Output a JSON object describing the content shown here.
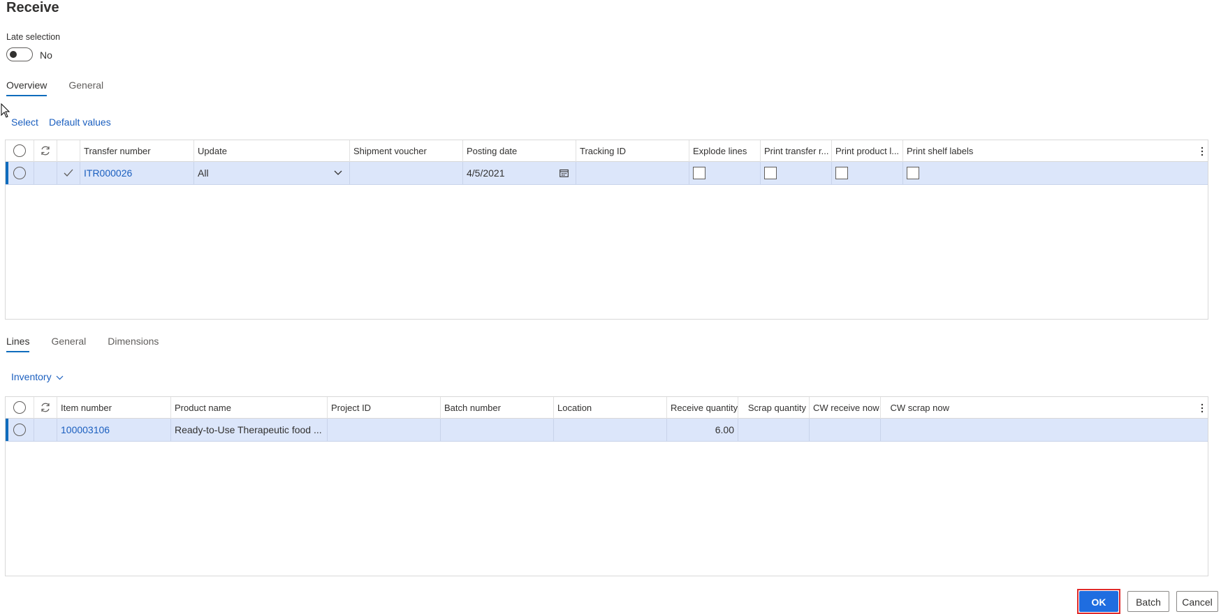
{
  "page": {
    "title": "Receive"
  },
  "late_selection": {
    "label": "Late selection",
    "value": "No"
  },
  "upper_tabs": [
    "Overview",
    "General"
  ],
  "upper_actions": {
    "select": "Select",
    "default_values": "Default values"
  },
  "header_grid": {
    "columns": [
      "Transfer number",
      "Update",
      "Shipment voucher",
      "Posting date",
      "Tracking ID",
      "Explode lines",
      "Print transfer r...",
      "Print product l...",
      "Print shelf labels"
    ],
    "rows": [
      {
        "transfer_number": "ITR000026",
        "update": "All",
        "shipment_voucher": "",
        "posting_date": "4/5/2021",
        "tracking_id": ""
      }
    ]
  },
  "lower_tabs": [
    "Lines",
    "General",
    "Dimensions"
  ],
  "lower_actions": {
    "inventory": "Inventory"
  },
  "lines_grid": {
    "columns": [
      "Item number",
      "Product name",
      "Project ID",
      "Batch number",
      "Location",
      "Receive quantity",
      "Scrap quantity",
      "CW receive now",
      "CW scrap now"
    ],
    "rows": [
      {
        "item_number": "100003106",
        "product_name": "Ready-to-Use Therapeutic food ...",
        "project_id": "",
        "batch_number": "",
        "location": "",
        "receive_quantity": "6.00",
        "scrap_quantity": "",
        "cw_receive_now": "",
        "cw_scrap_now": ""
      }
    ]
  },
  "footer": {
    "ok": "OK",
    "batch": "Batch",
    "cancel": "Cancel"
  },
  "colors": {
    "accent": "#0f6cbd",
    "link": "#1b5fbf",
    "selected_row": "#dce6fa",
    "primary_button": "#1f6de0",
    "highlight_outline": "#e02a2a"
  },
  "icons": [
    "refresh-icon",
    "check-icon",
    "chevron-down-icon",
    "calendar-icon",
    "more-vertical-icon",
    "mouse-cursor-icon"
  ]
}
